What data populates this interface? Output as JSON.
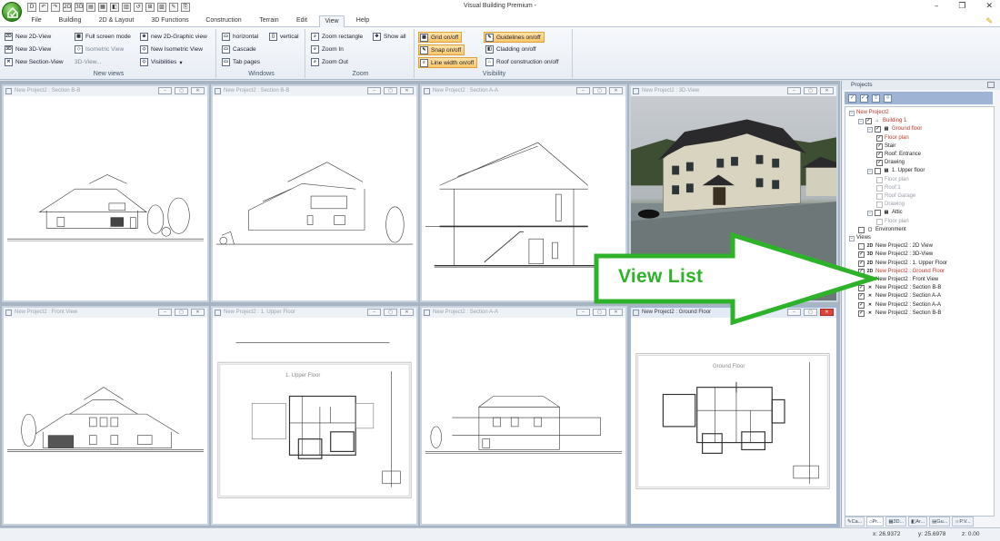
{
  "window": {
    "title": "Visual Building Premium -",
    "controls": [
      "–",
      "❐",
      "✕"
    ]
  },
  "quick_access": [
    "D",
    "↶",
    "↷",
    "2D",
    "3D",
    "▤",
    "▦",
    "◧",
    "▥",
    "↺",
    "⊞",
    "▨",
    "✎",
    "⎘"
  ],
  "tabs": [
    {
      "label": "File"
    },
    {
      "label": "Building"
    },
    {
      "label": "2D & Layout"
    },
    {
      "label": "3D Functions"
    },
    {
      "label": "Construction"
    },
    {
      "label": "Terrain"
    },
    {
      "label": "Edit"
    },
    {
      "label": "View",
      "active": true
    },
    {
      "label": "Help"
    }
  ],
  "ribbon": {
    "new_views": {
      "label": "New views",
      "buttons": [
        {
          "icon": "2D",
          "label": "New 2D-View"
        },
        {
          "icon": "3D",
          "label": "New 3D-View"
        },
        {
          "icon": "✕",
          "label": "New Section-View"
        },
        {
          "icon": "▦",
          "label": "Full screen mode"
        },
        {
          "icon": "◇",
          "label": "Isometric View"
        },
        {
          "icon": "",
          "label": "3D-View..."
        },
        {
          "icon": "⊕",
          "label": "new 2D-Graphic view"
        },
        {
          "icon": "◇",
          "label": "New Isometric View"
        },
        {
          "icon": "◇",
          "label": "Visibilities"
        }
      ]
    },
    "windows": {
      "label": "Windows",
      "buttons": [
        {
          "icon": "▭",
          "label": "horizontal"
        },
        {
          "icon": "▯",
          "label": "vertical"
        },
        {
          "icon": "▭",
          "label": "Cascade"
        },
        {
          "icon": "▭",
          "label": "Tab pages"
        }
      ]
    },
    "zoom": {
      "label": "Zoom",
      "buttons": [
        {
          "icon": "⌕",
          "label": "Zoom rectangle"
        },
        {
          "icon": "✥",
          "label": "Show all"
        },
        {
          "icon": "⌕",
          "label": "Zoom In"
        },
        {
          "icon": "⌕",
          "label": "Zoom Out"
        }
      ]
    },
    "visibility": {
      "label": "Visibility",
      "buttons": [
        {
          "icon": "▦",
          "label": "Grid on/off",
          "highlight": true
        },
        {
          "icon": "✎",
          "label": "Snap on/off",
          "highlight": true
        },
        {
          "icon": "≡",
          "label": "Line width on/off",
          "highlight": true
        },
        {
          "icon": "✎",
          "label": "Guidelines on/off",
          "highlight": true
        },
        {
          "icon": "◧",
          "label": "Cladding on/off"
        },
        {
          "icon": "⌂",
          "label": "Roof construction on/off"
        }
      ]
    }
  },
  "windows": [
    {
      "title": "New Project2 : Section B-B",
      "active": false
    },
    {
      "title": "New Project2 : Section B-B",
      "active": false
    },
    {
      "title": "New Project2 : Section A-A",
      "active": false
    },
    {
      "title": "New Project2 : 3D-View",
      "active": false
    },
    {
      "title": "New Project2 : Front View",
      "active": false
    },
    {
      "title": "New Project2 : 1. Upper Floor",
      "active": false
    },
    {
      "title": "New Project2 : Section A-A",
      "active": false
    },
    {
      "title": "New Project2 : Ground Floor",
      "active": true
    }
  ],
  "drawing_labels": {
    "upper_floor": "1. Upper Floor",
    "ground_floor": "Ground Floor"
  },
  "panel": {
    "title": "Projects",
    "toolbar": [
      "✓",
      "✓✓",
      "⇧",
      "⇩"
    ],
    "tree": [
      {
        "label": "New Project2",
        "level": 0,
        "style": "red",
        "exp": "−"
      },
      {
        "label": "Building 1",
        "level": 1,
        "style": "red",
        "exp": "−",
        "chk": "✓",
        "icon": "⌂"
      },
      {
        "label": "Ground floor",
        "level": 2,
        "style": "red",
        "exp": "−",
        "chk": "✓",
        "icon": "▤"
      },
      {
        "label": "Floor plan",
        "level": 3,
        "style": "red",
        "chk": "✓"
      },
      {
        "label": "Stair",
        "level": 3,
        "chk": "✓"
      },
      {
        "label": "Roof: Entrance",
        "level": 3,
        "chk": "✓"
      },
      {
        "label": "Drawing",
        "level": 3,
        "chk": "✓"
      },
      {
        "label": "1. Upper floor",
        "level": 2,
        "exp": "−",
        "chk": "",
        "icon": "▤"
      },
      {
        "label": "Floor plan",
        "level": 3,
        "style": "gray",
        "chk": "off"
      },
      {
        "label": "Roof:1",
        "level": 3,
        "style": "gray",
        "chk": "off"
      },
      {
        "label": "Roof Garage",
        "level": 3,
        "style": "gray",
        "chk": "off"
      },
      {
        "label": "Drawing",
        "level": 3,
        "style": "gray",
        "chk": "off"
      },
      {
        "label": "Attic",
        "level": 2,
        "exp": "−",
        "chk": "",
        "icon": "▤"
      },
      {
        "label": "Floor plan",
        "level": 3,
        "style": "gray",
        "chk": "off"
      },
      {
        "label": "Environment",
        "level": 1,
        "chk": "",
        "icon": "▢"
      },
      {
        "label": "Views",
        "level": 0,
        "exp": "−"
      },
      {
        "label": "New Project2 : 2D View",
        "level": 1,
        "chk": "",
        "icon": "2D"
      },
      {
        "label": "New Project2 : 3D-View",
        "level": 1,
        "chk": "✓",
        "icon": "3D"
      },
      {
        "label": "New Project2 : 1. Upper Floor",
        "level": 1,
        "chk": "✓",
        "icon": "2D"
      },
      {
        "label": "New Project2 : Ground Floor",
        "level": 1,
        "style": "red",
        "chk": "✓",
        "icon": "2D"
      },
      {
        "label": "New Project2 : Front View",
        "level": 1,
        "chk": "✓",
        "icon": "✕"
      },
      {
        "label": "New Project2 : Section B-B",
        "level": 1,
        "chk": "✓",
        "icon": "✕"
      },
      {
        "label": "New Project2 : Section A-A",
        "level": 1,
        "chk": "✓",
        "icon": "✕"
      },
      {
        "label": "New Project2 : Section A-A",
        "level": 1,
        "chk": "✓",
        "icon": "✕"
      },
      {
        "label": "New Project2 : Section B-B",
        "level": 1,
        "chk": "✓",
        "icon": "✕"
      }
    ],
    "bottom_tabs": [
      {
        "label": "Ca...",
        "icon": "✎"
      },
      {
        "label": "Pr...",
        "icon": "⌂",
        "selected": true
      },
      {
        "label": "3D...",
        "icon": "▦"
      },
      {
        "label": "Ar...",
        "icon": "◧"
      },
      {
        "label": "Gu...",
        "icon": "▤"
      },
      {
        "label": "P.V...",
        "icon": "☼"
      }
    ]
  },
  "status": {
    "x": "x: 26.9372",
    "y": "y: 25.6978",
    "z": "z: 0.00"
  },
  "annotation": {
    "label": "View List",
    "color": "#2db229"
  }
}
